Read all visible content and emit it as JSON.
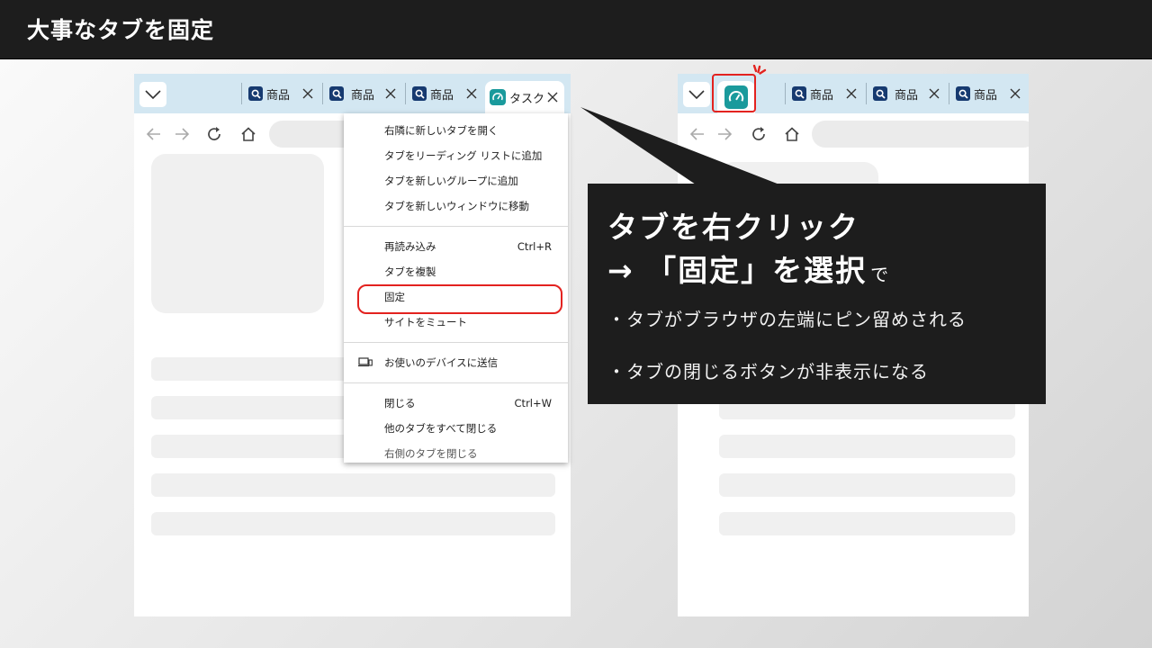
{
  "slide": {
    "title": "大事なタブを固定"
  },
  "left_browser": {
    "tabs": [
      {
        "label": "商品",
        "icon": "search-favicon"
      },
      {
        "label": "商品",
        "icon": "search-favicon"
      },
      {
        "label": "商品",
        "icon": "search-favicon"
      },
      {
        "label": "タスク",
        "icon": "gauge-favicon",
        "active": true
      }
    ]
  },
  "context_menu": {
    "items": [
      {
        "label": "右隣に新しいタブを開く",
        "shortcut": ""
      },
      {
        "label": "タブをリーディング リストに追加",
        "shortcut": ""
      },
      {
        "label": "タブを新しいグループに追加",
        "shortcut": ""
      },
      {
        "label": "タブを新しいウィンドウに移動",
        "shortcut": ""
      },
      {
        "label": "再読み込み",
        "shortcut": "Ctrl+R"
      },
      {
        "label": "タブを複製",
        "shortcut": ""
      },
      {
        "label": "固定",
        "shortcut": "",
        "highlighted": true
      },
      {
        "label": "サイトをミュート",
        "shortcut": ""
      },
      {
        "label": "お使いのデバイスに送信",
        "shortcut": "",
        "icon": "device-icon"
      },
      {
        "label": "閉じる",
        "shortcut": "Ctrl+W"
      },
      {
        "label": "他のタブをすべて閉じる",
        "shortcut": ""
      },
      {
        "label": "右側のタブを閉じる",
        "shortcut": ""
      }
    ]
  },
  "callout": {
    "line1": "タブを右クリック",
    "line2_main": "→ 「固定」を選択",
    "line2_suffix": "で",
    "bullets": [
      "・タブがブラウザの左端にピン留めされる",
      "・タブの閉じるボタンが非表示になる"
    ]
  },
  "right_browser": {
    "pinned_tab_icon": "gauge-favicon",
    "tabs": [
      {
        "label": "商品",
        "icon": "search-favicon"
      },
      {
        "label": "商品",
        "icon": "search-favicon"
      },
      {
        "label": "商品",
        "icon": "search-favicon"
      }
    ]
  },
  "colors": {
    "tabstrip": "#d3e7f2",
    "highlight": "#e3221f",
    "title_bar": "#1d1d1d",
    "pinned_favicon": "#1a9a9c",
    "search_favicon": "#163a70"
  }
}
